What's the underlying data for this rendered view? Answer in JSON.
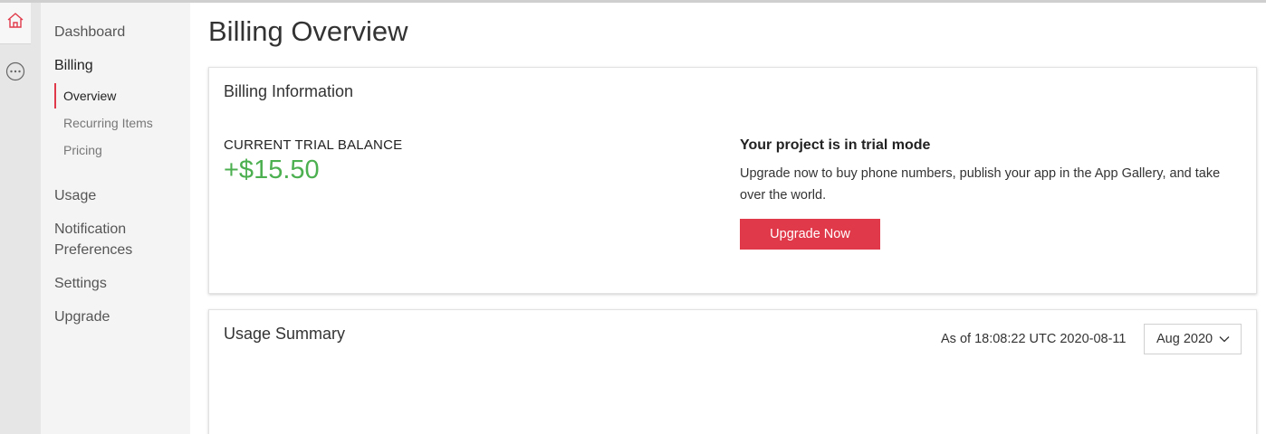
{
  "rail": {
    "icons": [
      "home-icon",
      "more-options-icon"
    ]
  },
  "sidebar": {
    "dashboard": "Dashboard",
    "billing": "Billing",
    "billing_items": [
      {
        "label": "Overview",
        "active": true
      },
      {
        "label": "Recurring Items",
        "active": false
      },
      {
        "label": "Pricing",
        "active": false
      }
    ],
    "usage": "Usage",
    "notification_line1": "Notification",
    "notification_line2": "Preferences",
    "settings": "Settings",
    "upgrade": "Upgrade"
  },
  "main": {
    "title": "Billing Overview",
    "billing_card": {
      "title": "Billing Information",
      "balance_label": "CURRENT TRIAL BALANCE",
      "balance_value": "+$15.50",
      "trial_heading": "Your project is in trial mode",
      "trial_text": "Upgrade now to buy phone numbers, publish your app in the App Gallery, and take over the world.",
      "upgrade_button": "Upgrade Now"
    },
    "usage_card": {
      "title": "Usage Summary",
      "as_of": "As of 18:08:22 UTC 2020-08-11",
      "month_selected": "Aug 2020"
    }
  },
  "colors": {
    "accent": "#e03a4a",
    "balance": "#4caf50"
  }
}
